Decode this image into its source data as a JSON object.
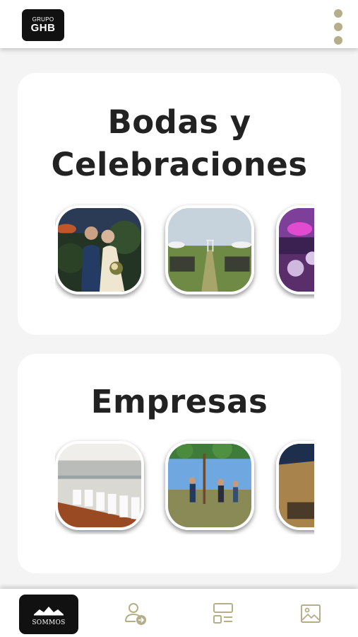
{
  "header": {
    "logo_line1": "GRUPO",
    "logo_line2": "GHB",
    "menu_icon": "kebab-menu-icon"
  },
  "sections": [
    {
      "title_line1": "Bodas y",
      "title_line2": "Celebraciones",
      "thumbnails": [
        "wedding-couple-photo",
        "outdoor-ceremony-photo",
        "banquet-hall-photo"
      ]
    },
    {
      "title": "Empresas",
      "thumbnails": [
        "conference-room-photo",
        "segway-activity-photo",
        "building-exterior-photo"
      ]
    }
  ],
  "bottom_nav": {
    "home_brand": "SOMMOS",
    "items": [
      "home-logo-icon",
      "user-login-icon",
      "layout-icon",
      "gallery-icon"
    ]
  },
  "colors": {
    "accent": "#b5ae8a",
    "dark": "#111111",
    "title": "#222222",
    "background": "#f4f4f4"
  }
}
